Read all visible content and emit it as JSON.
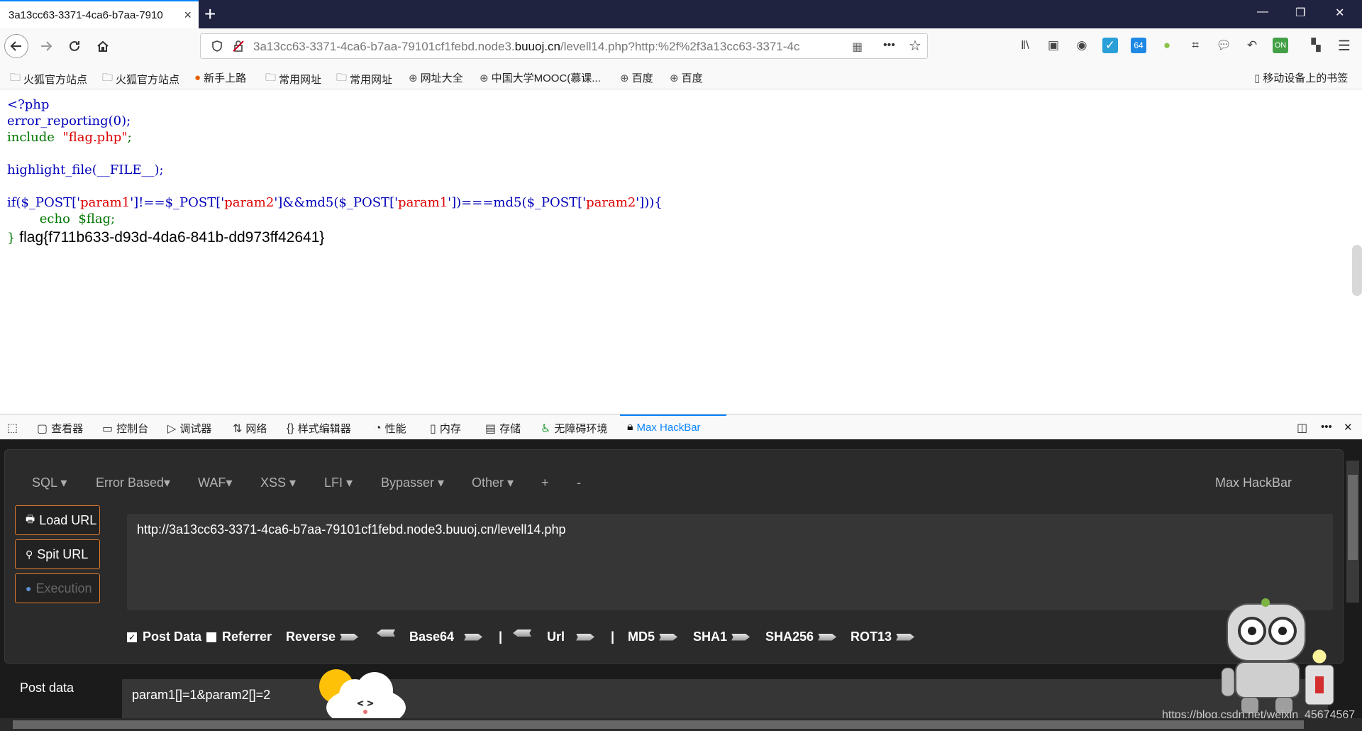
{
  "tab": {
    "title": "3a13cc63-3371-4ca6-b7aa-7910",
    "close": "×",
    "new": "+"
  },
  "window": {
    "min": "—",
    "restore": "❐",
    "close": "✕"
  },
  "nav": {
    "url_prefix": "3a13cc63-3371-4ca6-b7aa-79101cf1febd.node3.",
    "url_domain": "buuoj.cn",
    "url_suffix": "/levell14.php?http:%2f%2f3a13cc63-3371-4c",
    "more": "•••"
  },
  "bookmarks": [
    "火狐官方站点",
    "火狐官方站点",
    "新手上路",
    "常用网址",
    "常用网址",
    "网址大全",
    "中国大学MOOC(慕课...",
    "百度",
    "百度"
  ],
  "mobile_bookmarks": "移动设备上的书签",
  "code": {
    "line1": "<?php",
    "line2": "error_reporting(0);",
    "line3_kw": "include",
    "line3_str": "\"flag.php\"",
    "line3_end": ";",
    "line4": "highlight_file(__FILE__);",
    "line5_a": "if($_POST['",
    "line5_b": "param1",
    "line5_c": "']!==$_POST['",
    "line5_d": "param2",
    "line5_e": "']&&md5($_POST['",
    "line5_f": "param1",
    "line5_g": "'])===md5($_POST['",
    "line5_h": "param2",
    "line5_i": "'])){",
    "line6": "        echo  $flag;",
    "line7_brace": "}",
    "flag": "flag{f711b633-d93d-4da6-841b-dd973ff42641}"
  },
  "devtools": {
    "inspector": "查看器",
    "console": "控制台",
    "debugger": "调试器",
    "network": "网络",
    "style": "样式编辑器",
    "performance": "性能",
    "memory": "内存",
    "storage": "存储",
    "accessibility": "无障碍环境",
    "hackbar": "Max HackBar",
    "more": "•••",
    "close": "✕"
  },
  "hackbar": {
    "menus": [
      "SQL ▾",
      "Error Based▾",
      "WAF▾",
      "XSS ▾",
      "LFI ▾",
      "Bypasser ▾",
      "Other ▾",
      "+",
      "-"
    ],
    "brand": "Max HackBar",
    "load_url": "Load URL",
    "split_url": "Spit URL",
    "execution": "Execution",
    "url_value": "http://3a13cc63-3371-4ca6-b7aa-79101cf1febd.node3.buuoj.cn/levell14.php",
    "post_data_opt": "Post Data",
    "referrer_opt": "Referrer",
    "reverse": "Reverse",
    "base64": "Base64",
    "sep": "|",
    "url": "Url",
    "md5": "MD5",
    "sha1": "SHA1",
    "sha256": "SHA256",
    "rot13": "ROT13",
    "post_label": "Post data",
    "post_value": "param1[]=1&param2[]=2",
    "watermark": "https://blog.csdn.net/weixin_45674567"
  }
}
